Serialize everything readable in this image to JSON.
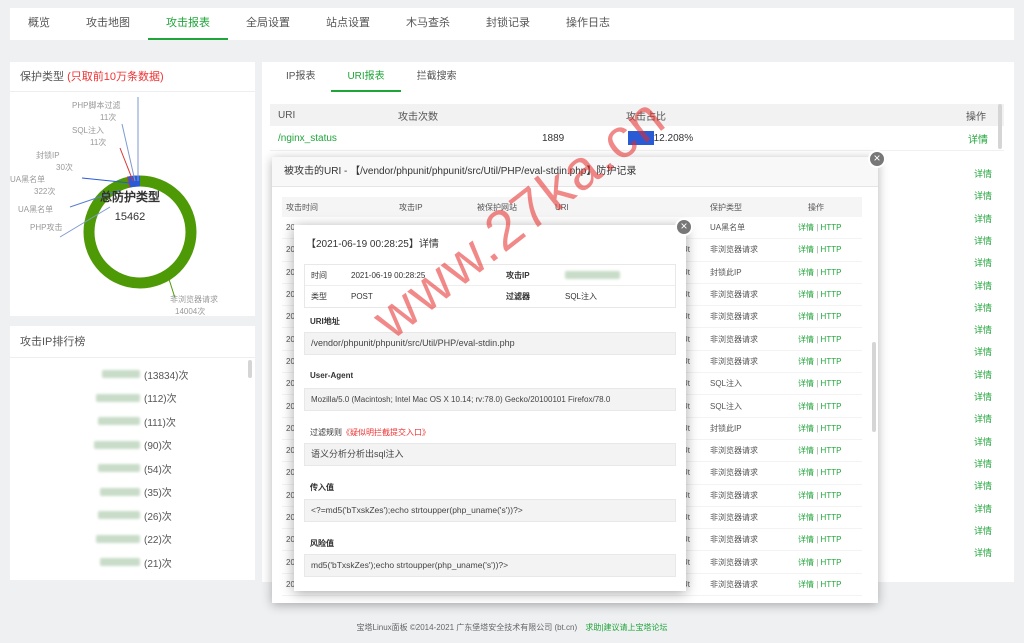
{
  "nav": {
    "tabs": [
      "概览",
      "攻击地图",
      "攻击报表",
      "全局设置",
      "站点设置",
      "木马查杀",
      "封锁记录",
      "操作日志"
    ],
    "active": 2
  },
  "protect_panel": {
    "title": "保护类型",
    "title_note": "(只取前10万条数据)",
    "center_title": "总防护类型",
    "center_value": "15462",
    "slices": [
      {
        "label": "非浏览器请求",
        "value": "14004次",
        "color": "#4e9a06"
      },
      {
        "label": "SQL注入",
        "value": "11次",
        "color": "#d33"
      },
      {
        "label": "封锁IP",
        "value": "",
        "color": "#2a5bd7"
      },
      {
        "label": "UA黑名单",
        "value": "",
        "color": "#5a7fd0"
      },
      {
        "label": "PHP攻击",
        "value": "",
        "color": "#7f9ad0"
      }
    ],
    "pie_labels": [
      "PHP脚本过滤",
      "11次",
      "SQL注入",
      "11次",
      "封锁IP",
      "30次",
      "UA黑名单",
      "322次",
      "UA黑名单",
      "PHP攻击",
      "非浏览器请求",
      "14004次"
    ]
  },
  "rank_panel": {
    "title": "攻击IP排行榜",
    "rows": [
      "(13834)次",
      "(112)次",
      "(111)次",
      "(90)次",
      "(54)次",
      "(35)次",
      "(26)次",
      "(22)次",
      "(21)次"
    ]
  },
  "subtabs": [
    "IP报表",
    "URI报表",
    "拦截搜索"
  ],
  "uri_table": {
    "headers": [
      "URI",
      "攻击次数",
      "攻击占比",
      "操作"
    ],
    "row": {
      "uri": "/nginx_status",
      "count": "1889",
      "ratio": "12.208%",
      "ratio_value": 12.208,
      "action": "详情"
    },
    "other_actions": [
      "详情",
      "详情",
      "详情",
      "详情",
      "详情",
      "详情",
      "详情",
      "详情",
      "详情",
      "详情",
      "详情",
      "详情",
      "详情",
      "详情",
      "详情",
      "详情",
      "详情",
      "详情"
    ]
  },
  "modal1": {
    "title": "被攻击的URI - 【/vendor/phpunit/phpunit/src/Util/PHP/eval-stdin.php】防护记录",
    "headers": [
      "攻击时间",
      "攻击IP",
      "被保护网站",
      "URI",
      "保护类型",
      "操作"
    ],
    "rows": [
      {
        "type": "UA黑名单"
      },
      {
        "type": "非浏览器请求"
      },
      {
        "type": "封锁此IP"
      },
      {
        "type": "非浏览器请求"
      },
      {
        "type": "非浏览器请求"
      },
      {
        "type": "非浏览器请求"
      },
      {
        "type": "非浏览器请求"
      },
      {
        "type": "SQL注入"
      },
      {
        "type": "SQL注入"
      },
      {
        "type": "封锁此IP"
      },
      {
        "type": "非浏览器请求"
      },
      {
        "type": "非浏览器请求"
      },
      {
        "type": "非浏览器请求"
      },
      {
        "type": "非浏览器请求"
      },
      {
        "type": "非浏览器请求"
      },
      {
        "type": "非浏览器请求"
      },
      {
        "type": "非浏览器请求"
      }
    ],
    "row_time_prefix": "20",
    "row_uri_suffix": "/Ut",
    "action_detail": "详情",
    "action_sep": "|",
    "action_http": "HTTP"
  },
  "modal2": {
    "title": "【2021-06-19 00:28:25】详情",
    "time_label": "时间",
    "time_value": "2021-06-19 00:28:25",
    "ip_label": "攻击IP",
    "type_label": "类型",
    "type_value": "POST",
    "filter_label": "过滤器",
    "filter_value": "SQL注入",
    "uri_label": "URI地址",
    "uri_value": "/vendor/phpunit/phpunit/src/Util/PHP/eval-stdin.php",
    "ua_label": "User-Agent",
    "ua_value": "Mozilla/5.0 (Macintosh; Intel Mac OS X 10.14; rv:78.0) Gecko/20100101 Firefox/78.0",
    "rule_label": "过滤规则",
    "rule_note": "《疑似明拦截提交入口》",
    "rule_value": "语义分析分析出sql注入",
    "input_label": "传入值",
    "input_value": "<?=md5('bTxskZes');echo strtoupper(php_uname('s'))?>",
    "risk_label": "风险值",
    "risk_value": "md5('bTxskZes');echo strtoupper(php_uname('s'))?>"
  },
  "watermark": "www.27ka.cn",
  "footer": {
    "text": "宝塔Linux面板 ©2014-2021 广东堡塔安全技术有限公司 (bt.cn)",
    "link": "求助|建议请上宝塔论坛"
  }
}
